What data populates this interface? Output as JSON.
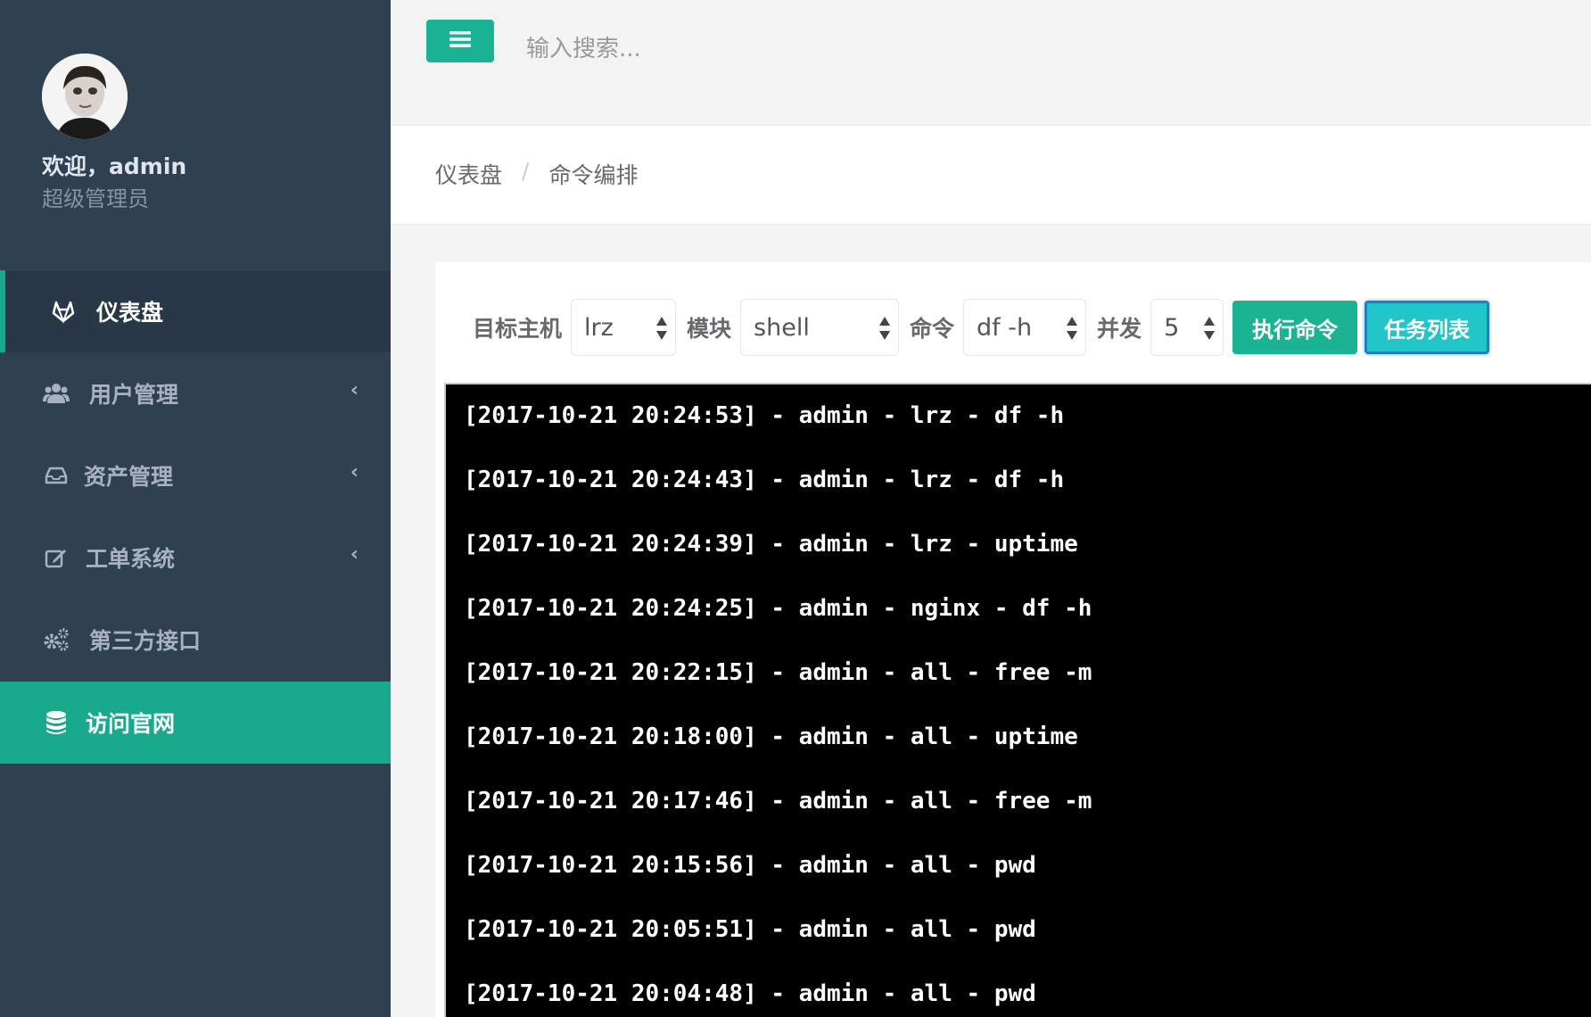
{
  "sidebar": {
    "welcome": "欢迎，admin",
    "role": "超级管理员",
    "items": [
      {
        "label": "仪表盘",
        "icon": "gitlab-fox-icon"
      },
      {
        "label": "用户管理",
        "icon": "users-icon"
      },
      {
        "label": "资产管理",
        "icon": "inbox-icon"
      },
      {
        "label": "工单系统",
        "icon": "edit-icon"
      },
      {
        "label": "第三方接口",
        "icon": "gears-icon"
      },
      {
        "label": "访问官网",
        "icon": "database-icon"
      }
    ]
  },
  "topbar": {
    "search_placeholder": "输入搜索..."
  },
  "breadcrumb": {
    "home": "仪表盘",
    "separator": "/",
    "current": "命令编排"
  },
  "controls": {
    "host_label": "目标主机",
    "host_value": "lrz",
    "module_label": "模块",
    "module_value": "shell",
    "command_label": "命令",
    "command_value": "df -h",
    "concurrency_label": "并发",
    "concurrency_value": "5",
    "execute_label": "执行命令",
    "tasks_label": "任务列表"
  },
  "log": [
    "[2017-10-21 20:24:53] - admin - lrz - df -h",
    "[2017-10-21 20:24:43] - admin - lrz - df -h",
    "[2017-10-21 20:24:39] - admin - lrz - uptime",
    "[2017-10-21 20:24:25] - admin - nginx - df -h",
    "[2017-10-21 20:22:15] - admin - all - free -m",
    "[2017-10-21 20:18:00] - admin - all - uptime",
    "[2017-10-21 20:17:46] - admin - all - free -m",
    "[2017-10-21 20:15:56] - admin - all - pwd",
    "[2017-10-21 20:05:51] - admin - all - pwd",
    "[2017-10-21 20:04:48] - admin - all - pwd"
  ],
  "colors": {
    "sidebar_bg": "#2f4050",
    "accent": "#1ab394",
    "info": "#23c6c8"
  }
}
